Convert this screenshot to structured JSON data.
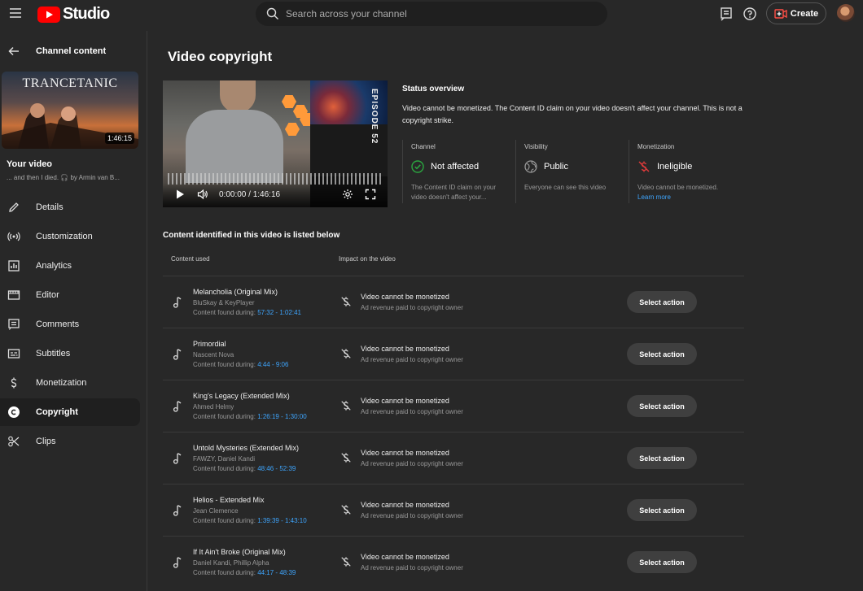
{
  "header": {
    "logo_text": "Studio",
    "search_placeholder": "Search across your channel",
    "create_label": "Create"
  },
  "sidebar": {
    "back_title": "Channel content",
    "thumbnail_title": "TRANCETANIC",
    "thumbnail_duration": "1:46:15",
    "your_video_label": "Your video",
    "video_subtitle": "... and then I died. 🎧 by Armin van B...",
    "items": [
      {
        "label": "Details",
        "icon": "pencil-icon"
      },
      {
        "label": "Customization",
        "icon": "broadcast-icon"
      },
      {
        "label": "Analytics",
        "icon": "analytics-icon"
      },
      {
        "label": "Editor",
        "icon": "editor-icon"
      },
      {
        "label": "Comments",
        "icon": "comments-icon"
      },
      {
        "label": "Subtitles",
        "icon": "subtitles-icon"
      },
      {
        "label": "Monetization",
        "icon": "dollar-icon"
      },
      {
        "label": "Copyright",
        "icon": "copyright-icon",
        "active": true
      },
      {
        "label": "Clips",
        "icon": "scissors-icon"
      }
    ]
  },
  "main": {
    "title": "Video copyright",
    "player": {
      "episode_label": "EPISODE 52",
      "time": "0:00:00 / 1:46:16"
    },
    "status": {
      "title": "Status overview",
      "text": "Video cannot be monetized. The Content ID claim on your video doesn't affect your channel. This is not a copyright strike.",
      "columns": [
        {
          "label": "Channel",
          "value": "Not affected",
          "desc": "The Content ID claim on your video doesn't affect your...",
          "icon": "check-circle-icon"
        },
        {
          "label": "Visibility",
          "value": "Public",
          "desc": "Everyone can see this video",
          "icon": "globe-icon"
        },
        {
          "label": "Monetization",
          "value": "Ineligible",
          "desc": "Video cannot be monetized.",
          "link": "Learn more",
          "icon": "no-monetization-icon"
        }
      ]
    },
    "content_heading": "Content identified in this video is listed below",
    "col_content_used": "Content used",
    "col_impact": "Impact on the video",
    "found_label": "Content found during:",
    "impact_title": "Video cannot be monetized",
    "impact_sub": "Ad revenue paid to copyright owner",
    "action_label": "Select action",
    "rows": [
      {
        "title": "Melancholia (Original Mix)",
        "artist": "BluSkay & KeyPlayer",
        "range": "57:32 - 1:02:41"
      },
      {
        "title": "Primordial",
        "artist": "Nascent Nova",
        "range": "4:44 - 9:06"
      },
      {
        "title": "King's Legacy (Extended Mix)",
        "artist": "Ahmed Helmy",
        "range": "1:26:19 - 1:30:00"
      },
      {
        "title": "Untold Mysteries (Extended Mix)",
        "artist": "FAWZY, Daniel Kandi",
        "range": "48:46 - 52:39"
      },
      {
        "title": "Helios - Extended Mix",
        "artist": "Jean Clemence",
        "range": "1:39:39 - 1:43:10"
      },
      {
        "title": "If It Ain't Broke (Original Mix)",
        "artist": "Daniel Kandi, Phillip Alpha",
        "range": "44:17 - 48:39"
      }
    ]
  },
  "colors": {
    "accent_link": "#3ea6ff",
    "brand_red": "#ff0000",
    "check_green": "#2ba640",
    "ineligible_red": "#e03a3a"
  }
}
